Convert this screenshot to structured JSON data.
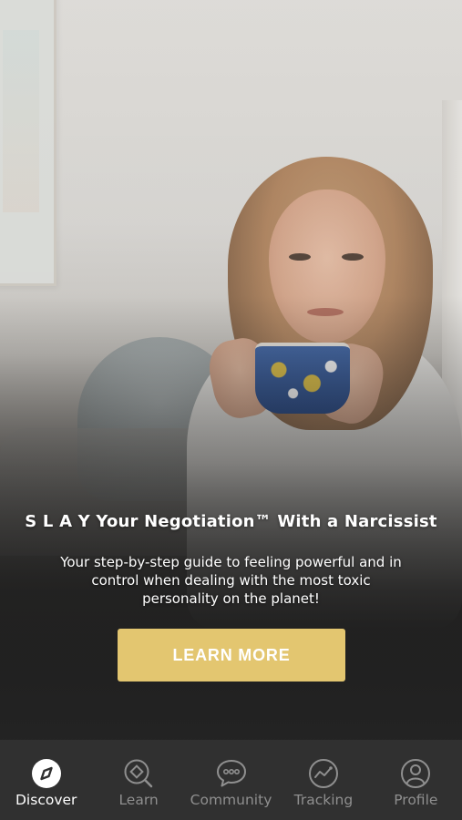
{
  "hero": {
    "title": "S L A Y Your Negotiation™ With a Narcissist",
    "description": "Your step-by-step guide to feeling powerful and in control when dealing with the most toxic personality on the planet!",
    "cta_label": "LEARN MORE"
  },
  "colors": {
    "accent": "#e3c670",
    "nav_background": "#303030",
    "nav_active": "#ffffff",
    "nav_inactive": "#8f8f8f"
  },
  "nav": {
    "active": "Discover",
    "items": [
      {
        "label": "Discover",
        "icon": "compass-icon"
      },
      {
        "label": "Learn",
        "icon": "learn-search-icon"
      },
      {
        "label": "Community",
        "icon": "chat-bubble-icon"
      },
      {
        "label": "Tracking",
        "icon": "trend-chart-icon"
      },
      {
        "label": "Profile",
        "icon": "user-profile-icon"
      }
    ]
  }
}
